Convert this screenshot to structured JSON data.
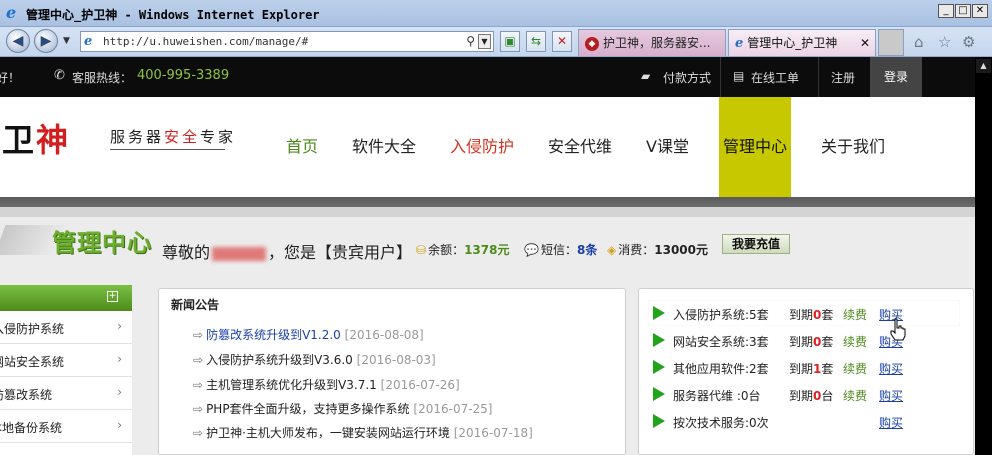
{
  "window": {
    "title": "管理中心_护卫神 - Windows Internet Explorer",
    "controls": [
      "_",
      "□",
      "✕"
    ]
  },
  "browser": {
    "url": "http://u.huweishen.com/manage/#",
    "tabs": [
      {
        "label": "护卫神，服务器安..."
      },
      {
        "label": "管理中心_护卫神"
      }
    ],
    "tab_close": "✕"
  },
  "topbar": {
    "hello": "您好！",
    "hotline_label": "客服热线：",
    "hotline_number": "400-995-3389",
    "payment": "付款方式",
    "ticket": "在线工单",
    "register": "注册",
    "login": "登录"
  },
  "header": {
    "logo_black": "护卫",
    "logo_red": "神",
    "slogan_a": "服务器",
    "slogan_red": "安全",
    "slogan_b": "专家",
    "menu": [
      {
        "label": "首页"
      },
      {
        "label": "软件大全"
      },
      {
        "label": "入侵防护"
      },
      {
        "label": "安全代维"
      },
      {
        "label": "V课堂"
      },
      {
        "label": "管理中心"
      },
      {
        "label": "关于我们"
      }
    ]
  },
  "userbar": {
    "section_title": "管理中心",
    "greeting_prefix": "尊敬的",
    "greeting_suffix": "，您是【贵宾用户】",
    "balance_label": "余额：",
    "balance_value": "1378元",
    "sms_label": "短信：",
    "sms_value": "8条",
    "spend_label": "消费：",
    "spend_value": "13000元",
    "recharge_button": "我要充值"
  },
  "sidebar": {
    "items": [
      {
        "label": "入侵防护系统"
      },
      {
        "label": "网站安全系统"
      },
      {
        "label": "防篡改系统"
      },
      {
        "label": "本地备份系统"
      }
    ]
  },
  "news": {
    "title": "新闻公告",
    "items": [
      {
        "text": "防篡改系统升级到V1.2.0",
        "date": "[2016-08-08]"
      },
      {
        "text": "入侵防护系统升级到V3.6.0",
        "date": "[2016-08-03]"
      },
      {
        "text": "主机管理系统优化升级到V3.7.1",
        "date": "[2016-07-26]"
      },
      {
        "text": "PHP套件全面升级，支持更多操作系统",
        "date": "[2016-07-25]"
      },
      {
        "text": "护卫神·主机大师发布，一键安装网站运行环境",
        "date": "[2016-07-18]"
      }
    ]
  },
  "services": {
    "expire_prefix": "到期",
    "renew_label": "续费",
    "buy_label": "购买",
    "rows": [
      {
        "name": "入侵防护系统:5套",
        "expired": "0",
        "unit": "套",
        "renew": true
      },
      {
        "name": "网站安全系统:3套",
        "expired": "0",
        "unit": "套",
        "renew": true
      },
      {
        "name": "其他应用软件:2套",
        "expired": "1",
        "unit": "套",
        "renew": true
      },
      {
        "name": "服务器代维 :0台",
        "expired": "0",
        "unit": "台",
        "renew": true
      },
      {
        "name": "按次技术服务:0次",
        "expired": "",
        "unit": "",
        "renew": false
      }
    ]
  },
  "colors": {
    "accent_green": "#6cae2e",
    "active_menu": "#c8c800",
    "link_blue": "#1a3fa8",
    "alert_red": "#e01e1e"
  }
}
